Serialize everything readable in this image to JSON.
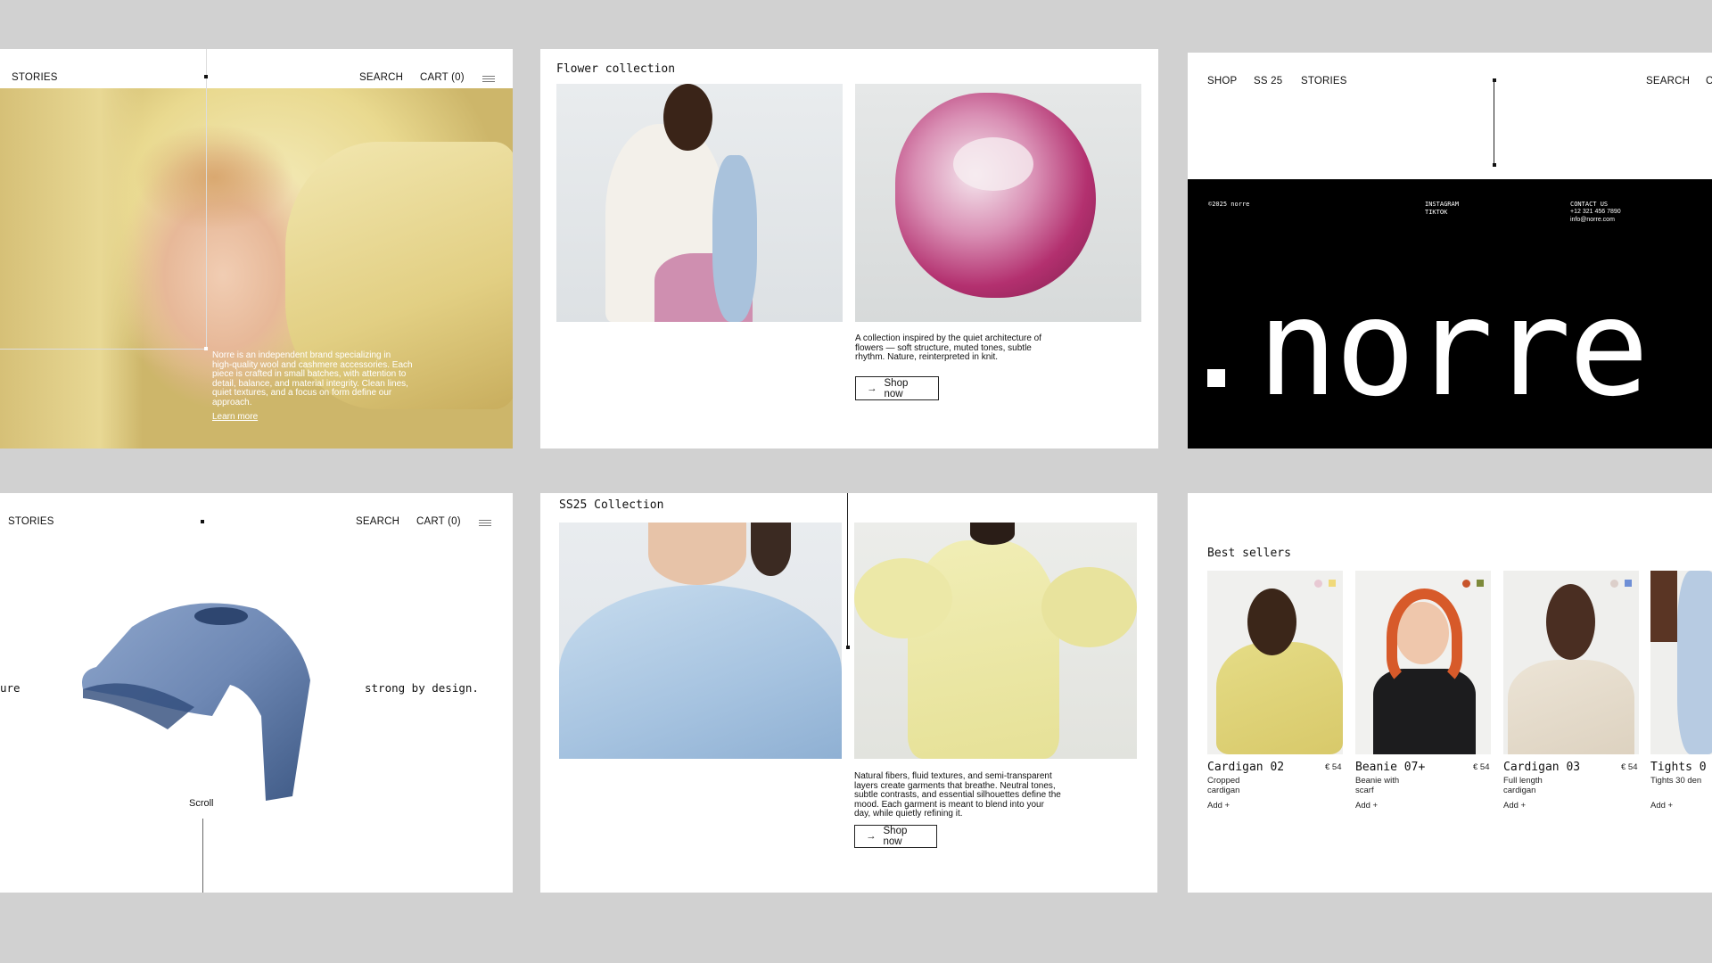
{
  "nav": {
    "stories": "STORIES",
    "search": "SEARCH",
    "cart": "CART (0)",
    "shop": "SHOP",
    "ss25": "SS 25"
  },
  "hero": {
    "paragraph": "Norre is an independent brand specializing in high-quality wool and cashmere accessories. Each piece is crafted in small batches, with attention to detail, balance, and material integrity. Clean lines, quiet textures, and a focus on form define our approach.",
    "link": "Learn more"
  },
  "flower": {
    "title": "Flower collection",
    "description": "A collection inspired by the quiet architecture of flowers — soft structure, muted tones, subtle rhythm. Nature, reinterpreted in knit.",
    "button": "Shop now"
  },
  "footer": {
    "copyright": "©2025 norre",
    "social": [
      "INSTAGRAM",
      "TIKTOK"
    ],
    "contact_label": "CONTACT US",
    "phone": "+12 321 456 7890",
    "email": "info@norre.com",
    "logo_text": "norre"
  },
  "scroll": {
    "left_text": "ure",
    "right_text": "strong by design.",
    "scroll_label": "Scroll"
  },
  "ss25": {
    "title": "SS25 Collection",
    "description": "Natural fibers, fluid textures, and semi-transparent layers create garments that breathe. Neutral tones, subtle contrasts, and essential silhouettes define the mood. Each garment is meant to blend into your day, while quietly refining it.",
    "button": "Shop now"
  },
  "bestsellers": {
    "title": "Best sellers",
    "products": [
      {
        "name": "Cardigan 02",
        "price": "€ 54",
        "desc": "Cropped cardigan",
        "add": "Add +",
        "colors": [
          "#e8c9d3",
          "#f0d97a"
        ]
      },
      {
        "name": "Beanie 07+",
        "price": "€ 54",
        "desc": "Beanie with scarf",
        "add": "Add +",
        "colors": [
          "#c8552b",
          "#7d8a3a"
        ]
      },
      {
        "name": "Cardigan 03",
        "price": "€ 54",
        "desc": "Full length cardigan",
        "add": "Add +",
        "colors": [
          "#dccfca",
          "#6f8fd6"
        ]
      },
      {
        "name": "Tights 0",
        "price": "",
        "desc": "Tights 30 den",
        "add": "Add +",
        "colors": []
      }
    ]
  },
  "colors": {
    "background": "#d1d1d1",
    "panel": "#ffffff",
    "black": "#000000",
    "hero_yellow": "#e8d89a",
    "sweater_blue": "#6e88b4"
  }
}
